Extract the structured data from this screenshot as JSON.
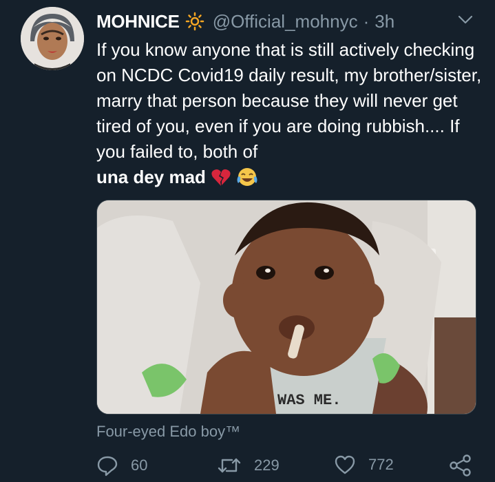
{
  "tweet": {
    "display_name": "MOHNICE",
    "handle": "@Official_mohnyc",
    "separator": "·",
    "time": "3h",
    "text_main": "If you know anyone that is still actively checking on NCDC Covid19 daily result, my brother/sister, marry that person because they will never get tired of you, even if you are doing rubbish.... If you failed to, both of",
    "text_bold": "una dey mad",
    "media_text": "WAS ME."
  },
  "caption": "Four-eyed Edo boy™",
  "actions": {
    "reply_count": "60",
    "retweet_count": "229",
    "like_count": "772"
  },
  "icons": {
    "sun": "sun-icon",
    "chevron": "chevron-down-icon",
    "broken_heart": "broken-heart-icon",
    "crying_laugh": "tears-of-joy-icon",
    "reply": "reply-icon",
    "retweet": "retweet-icon",
    "like": "heart-icon",
    "share": "share-icon"
  },
  "colors": {
    "background": "#15202b",
    "text": "#ffffff",
    "muted": "#8899a6",
    "sun": "#f5a623",
    "broken_heart": "#d7263d",
    "emoji_yellow": "#f5c64a"
  }
}
